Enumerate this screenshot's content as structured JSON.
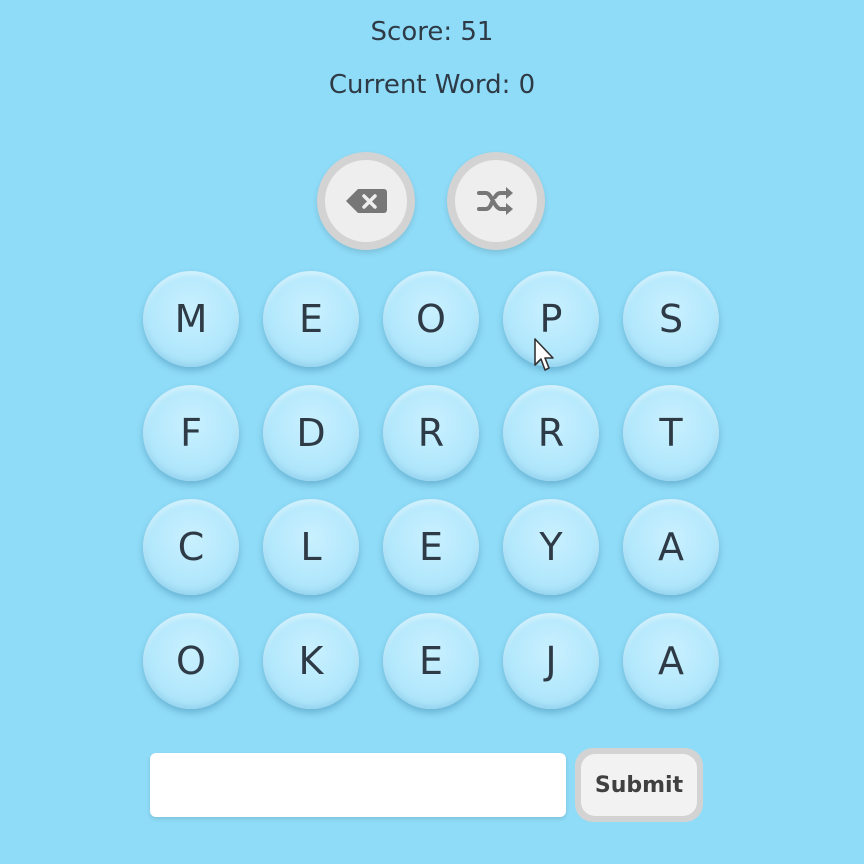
{
  "score": {
    "label": "Score: 51"
  },
  "current_word": {
    "label": "Current Word: 0"
  },
  "controls": {
    "delete_icon": "backspace-icon",
    "shuffle_icon": "shuffle-icon",
    "button_bg": "#eeeeee",
    "button_ring": "#d3d3d3"
  },
  "board": {
    "rows": [
      [
        "M",
        "E",
        "O",
        "P",
        "S"
      ],
      [
        "F",
        "D",
        "R",
        "R",
        "T"
      ],
      [
        "C",
        "L",
        "E",
        "Y",
        "A"
      ],
      [
        "O",
        "K",
        "E",
        "J",
        "A"
      ]
    ],
    "tile_color": "#b3e8fc"
  },
  "word_input": {
    "value": "",
    "placeholder": ""
  },
  "submit": {
    "label": "Submit"
  },
  "colors": {
    "background": "#8fdcf8",
    "text": "#2e3b47"
  }
}
